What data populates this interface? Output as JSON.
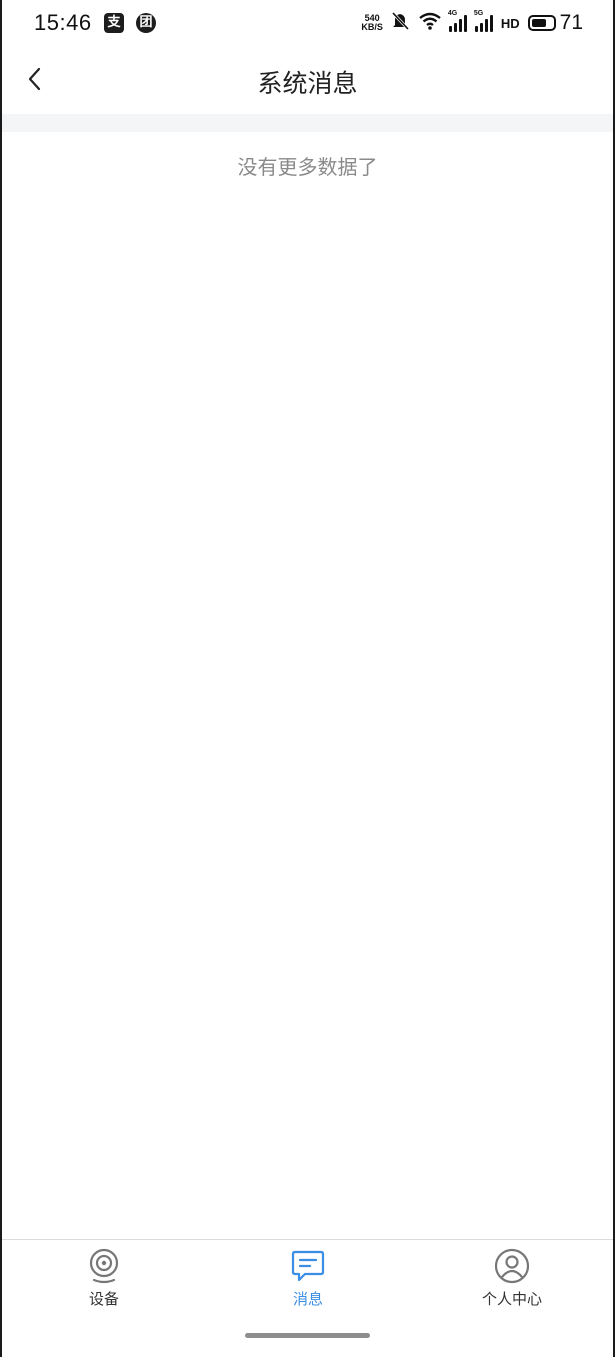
{
  "status_bar": {
    "time": "15:46",
    "app_icon_1": "支",
    "app_icon_2": "团",
    "net_speed_value": "540",
    "net_speed_unit": "KB/S",
    "signal_1_tag": "4G",
    "signal_2_tag": "5G",
    "hd_label": "HD",
    "battery_level": "71",
    "battery_fraction": 0.71,
    "icons": [
      "alipay-icon",
      "meituan-icon",
      "mute-icon",
      "wifi-icon",
      "signal-4g-icon",
      "signal-5g-icon",
      "hd-icon",
      "battery-icon"
    ]
  },
  "header": {
    "title": "系统消息",
    "back_icon": "chevron-left-icon"
  },
  "content": {
    "empty_text": "没有更多数据了"
  },
  "tab_bar": {
    "active_color": "#3a8ee6",
    "tabs": [
      {
        "label": "设备",
        "icon": "camera-icon",
        "active": false
      },
      {
        "label": "消息",
        "icon": "message-icon",
        "active": true
      },
      {
        "label": "个人中心",
        "icon": "user-icon",
        "active": false
      }
    ]
  }
}
